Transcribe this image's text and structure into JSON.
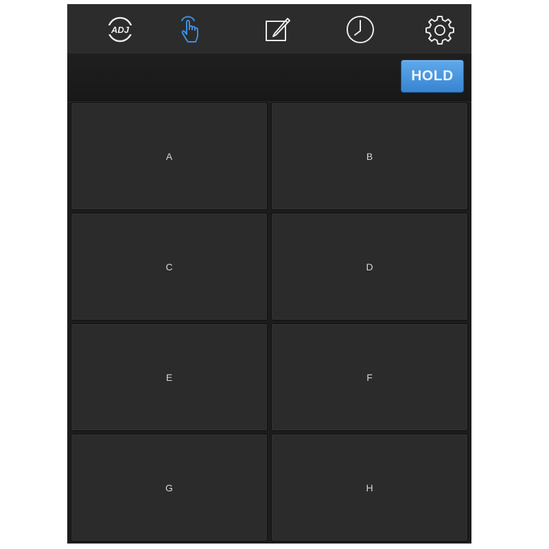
{
  "nav": {
    "items": [
      {
        "name": "adj-logo",
        "label": "ADJ"
      },
      {
        "name": "touch-hand-icon",
        "active": true
      },
      {
        "name": "edit-icon"
      },
      {
        "name": "clock-icon"
      },
      {
        "name": "gear-icon"
      }
    ]
  },
  "hold": {
    "label": "HOLD"
  },
  "pads": [
    {
      "label": "A"
    },
    {
      "label": "B"
    },
    {
      "label": "C"
    },
    {
      "label": "D"
    },
    {
      "label": "E"
    },
    {
      "label": "F"
    },
    {
      "label": "G"
    },
    {
      "label": "H"
    }
  ],
  "colors": {
    "active_icon": "#3f8fe0",
    "icon": "#ececec",
    "hold_button": "#4a97e0",
    "pad": "#2b2b2b",
    "background": "#1c1c1c"
  }
}
